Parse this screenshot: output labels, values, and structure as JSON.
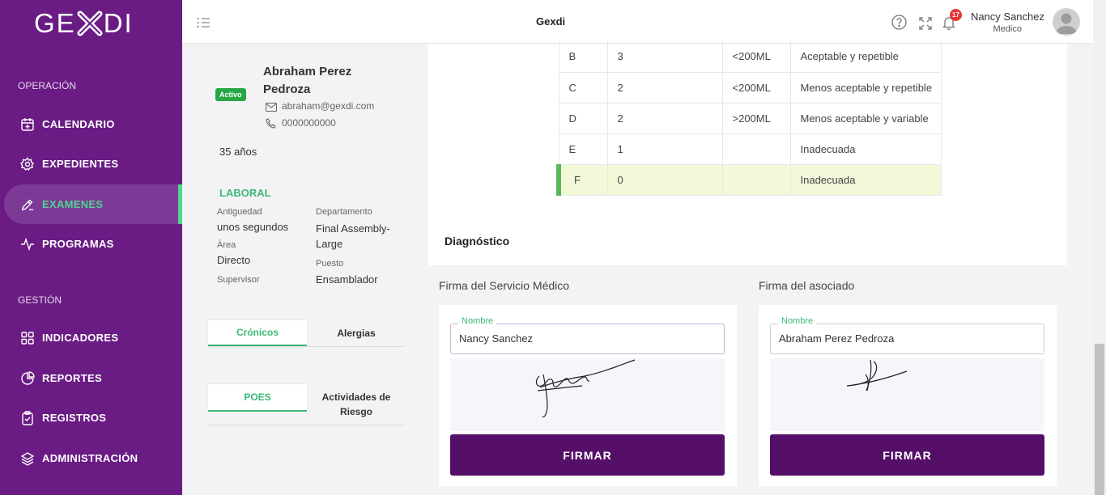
{
  "brand": {
    "logo_left": "GE",
    "logo_right": "DI"
  },
  "sidebar": {
    "section_operacion": "OPERACIÓN",
    "section_gestion": "GESTIÓN",
    "items": [
      {
        "label": "CALENDARIO",
        "icon": "calendar-icon"
      },
      {
        "label": "EXPEDIENTES",
        "icon": "gear-icon"
      },
      {
        "label": "EXAMENES",
        "icon": "pencil-icon",
        "active": true
      },
      {
        "label": "PROGRAMAS",
        "icon": "pulse-icon"
      },
      {
        "label": "INDICADORES",
        "icon": "grid-icon"
      },
      {
        "label": "REPORTES",
        "icon": "pie-chart-icon"
      },
      {
        "label": "REGISTROS",
        "icon": "clipboard-icon"
      },
      {
        "label": "ADMINISTRACIÓN",
        "icon": "layers-icon"
      }
    ]
  },
  "topbar": {
    "title": "Gexdi",
    "notifications": "17",
    "user_name": "Nancy Sanchez",
    "user_role": "Medico"
  },
  "patient": {
    "status": "Activo",
    "name": "Abraham Perez Pedroza",
    "email": "abraham@gexdi.com",
    "phone": "0000000000",
    "age": "35 años",
    "laboral_title": "LABORAL",
    "antiguedad_label": "Antiguedad",
    "antiguedad": "unos segundos",
    "area_label": "Área",
    "area": "Directo",
    "supervisor_label": "Supervisor",
    "departamento_label": "Departamento",
    "departamento": "Final Assembly-Large",
    "puesto_label": "Puesto",
    "puesto": "Ensamblador",
    "tabs1": [
      "Crónicos",
      "Alergias"
    ],
    "tabs2": [
      "POES",
      "Actividades de Riesgo"
    ]
  },
  "results_table": [
    {
      "grade": "B",
      "count": "3",
      "volume": "<200ML",
      "desc": "Aceptable y repetible"
    },
    {
      "grade": "C",
      "count": "2",
      "volume": "<200ML",
      "desc": "Menos aceptable y repetible"
    },
    {
      "grade": "D",
      "count": "2",
      "volume": ">200ML",
      "desc": "Menos aceptable y variable"
    },
    {
      "grade": "E",
      "count": "1",
      "volume": "",
      "desc": "Inadecuada"
    },
    {
      "grade": "F",
      "count": "0",
      "volume": "",
      "desc": "Inadecuada",
      "highlighted": true
    }
  ],
  "diagnostico_title": "Diagnóstico",
  "signatures": {
    "medico": {
      "title": "Firma del Servicio Médico",
      "field_label": "Nombre",
      "value": "Nancy Sanchez",
      "button": "FIRMAR"
    },
    "asociado": {
      "title": "Firma del asociado",
      "field_label": "Nombre",
      "value": "Abraham  Perez Pedroza",
      "button": "FIRMAR"
    }
  },
  "colors": {
    "sidebar": "#6a1b84",
    "accent_green": "#3cb878",
    "button": "#560f69",
    "highlight_row": "#f1f9d9"
  }
}
